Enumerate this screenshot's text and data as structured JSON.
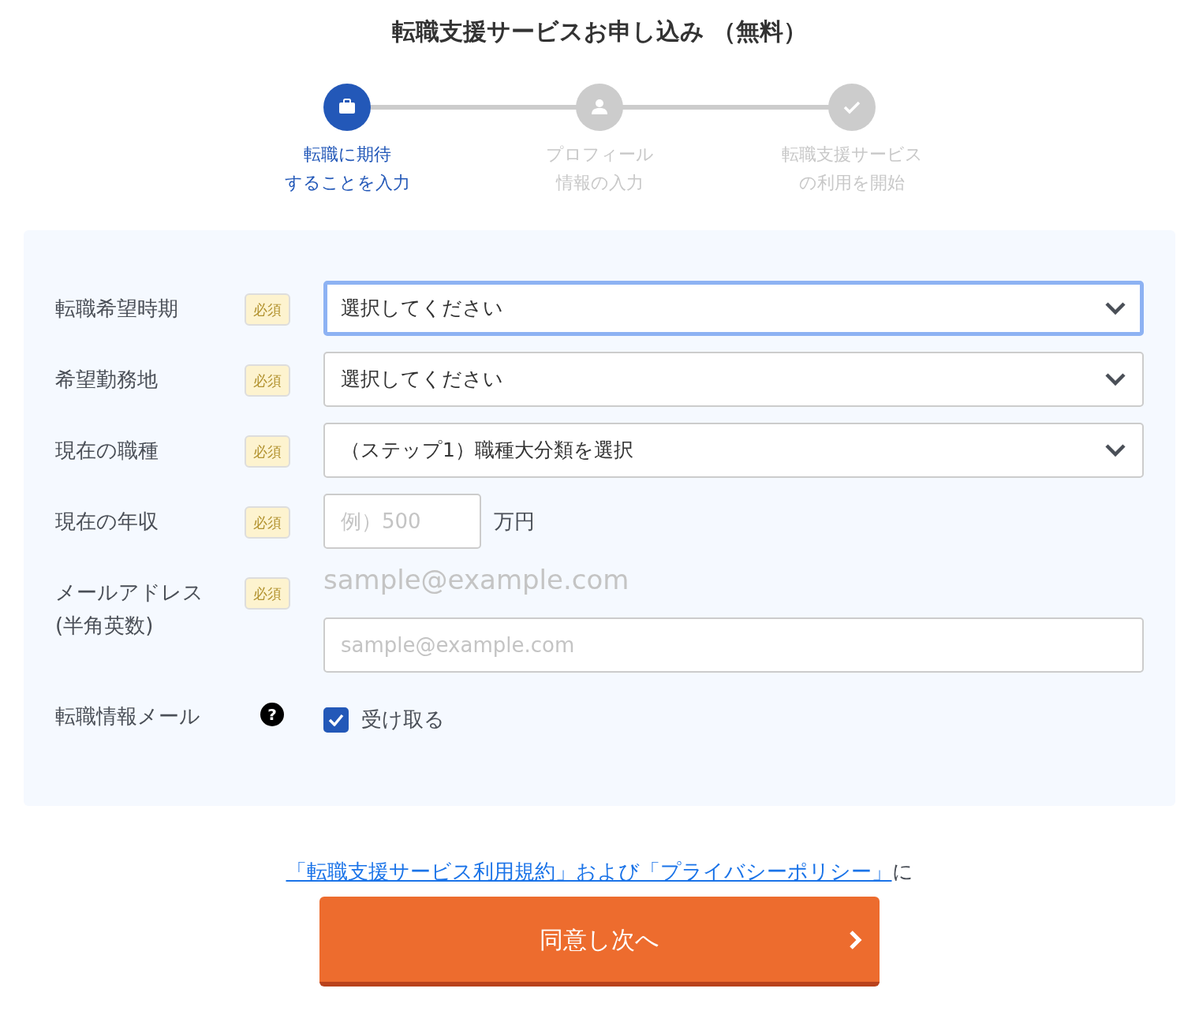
{
  "title": "転職支援サービスお申し込み （無料）",
  "steps": [
    {
      "kind": "briefcase",
      "lines": [
        "転職に期待",
        "することを入力"
      ],
      "selected": true
    },
    {
      "kind": "person",
      "lines": [
        "プロフィール",
        "情報の入力"
      ],
      "selected": false
    },
    {
      "kind": "check",
      "lines": [
        "転職支援サービス",
        "の利用を開始"
      ],
      "selected": false
    }
  ],
  "fields": [
    {
      "kind": "select",
      "label": [
        "転職希望時期"
      ],
      "badge": "必須",
      "value": "選択してください",
      "focused": true
    },
    {
      "kind": "select",
      "label": [
        "希望勤務地"
      ],
      "badge": "必須",
      "value": "選択してください",
      "focused": false
    },
    {
      "kind": "select",
      "label": [
        "現在の職種"
      ],
      "badge": "必須",
      "value": "（ステップ1）職種大分類を選択",
      "focused": false
    },
    {
      "kind": "number",
      "label": [
        "現在の年収"
      ],
      "badge": "必須",
      "placeholder": "例）500",
      "unit": "万円"
    },
    {
      "kind": "email",
      "label": [
        "メールアドレス",
        "(半角英数)"
      ],
      "badge": "必須",
      "hint": "sample@example.com",
      "placeholder": "sample@example.com"
    },
    {
      "kind": "checkbox",
      "label": [
        "転職情報メール"
      ],
      "help": "?",
      "option": "受け取る",
      "checked": true
    }
  ],
  "consent": {
    "link": "「転職支援サービス利用規約」および「プライバシーポリシー」",
    "text": "に"
  },
  "submit": {
    "label": "同意し次へ"
  }
}
